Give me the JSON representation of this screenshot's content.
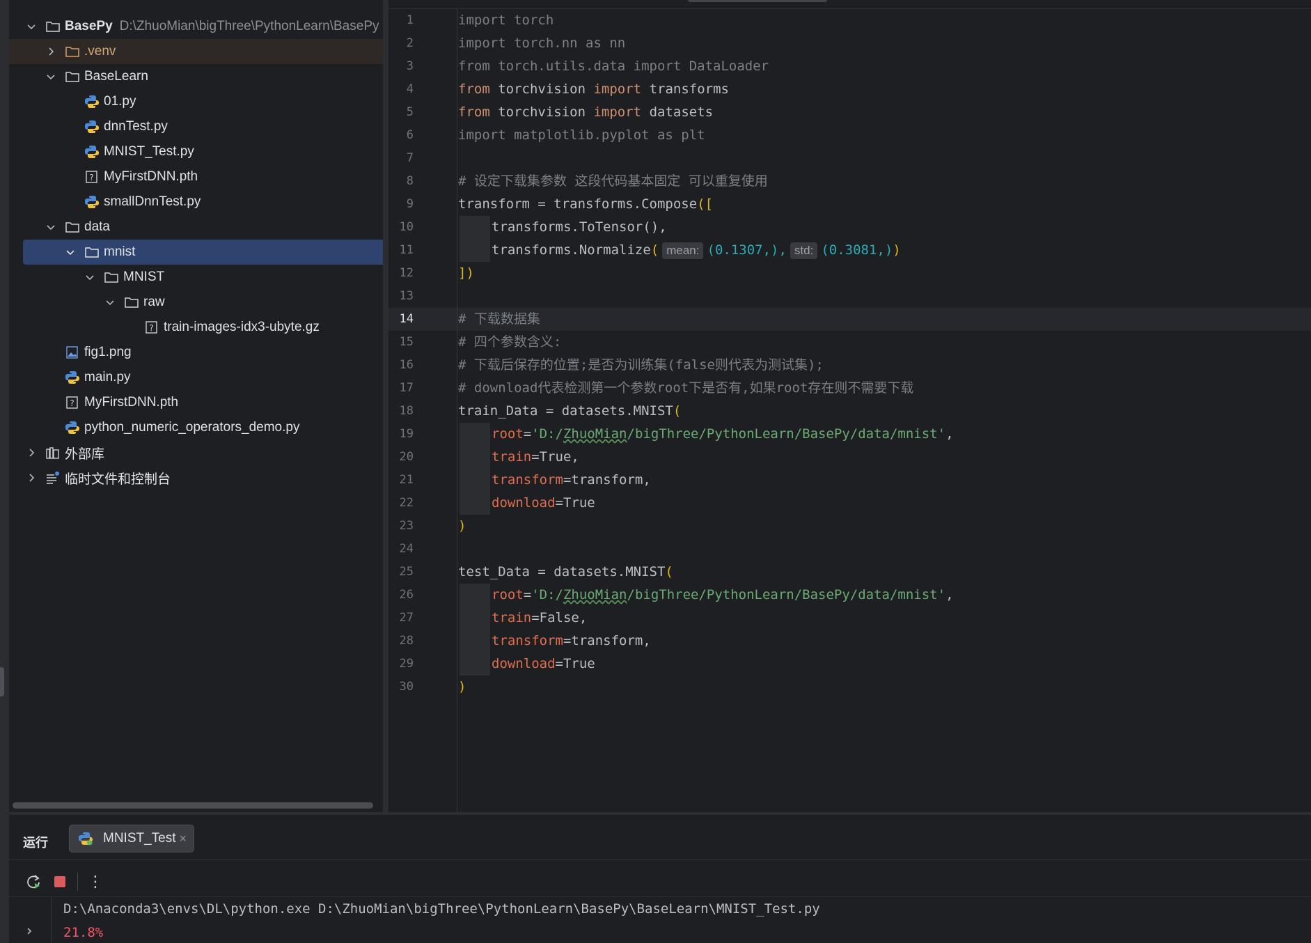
{
  "project_tree": {
    "root": {
      "label": "BasePy",
      "path": "D:\\ZhuoMian\\bigThree\\PythonLearn\\BasePy"
    },
    "items": [
      {
        "label": ".venv",
        "type": "folder-excluded",
        "expanded": false
      },
      {
        "label": "BaseLearn",
        "type": "folder",
        "expanded": true
      },
      {
        "label": "01.py",
        "type": "python"
      },
      {
        "label": "dnnTest.py",
        "type": "python"
      },
      {
        "label": "MNIST_Test.py",
        "type": "python"
      },
      {
        "label": "MyFirstDNN.pth",
        "type": "unknown"
      },
      {
        "label": "smallDnnTest.py",
        "type": "python"
      },
      {
        "label": "data",
        "type": "folder",
        "expanded": true
      },
      {
        "label": "mnist",
        "type": "folder",
        "expanded": true,
        "selected": true
      },
      {
        "label": "MNIST",
        "type": "folder",
        "expanded": true
      },
      {
        "label": "raw",
        "type": "folder",
        "expanded": true
      },
      {
        "label": "train-images-idx3-ubyte.gz",
        "type": "unknown"
      },
      {
        "label": "fig1.png",
        "type": "image"
      },
      {
        "label": "main.py",
        "type": "python"
      },
      {
        "label": "MyFirstDNN.pth",
        "type": "unknown"
      },
      {
        "label": "python_numeric_operators_demo.py",
        "type": "python"
      },
      {
        "label": "外部库",
        "type": "library",
        "expanded": false
      },
      {
        "label": "临时文件和控制台",
        "type": "scratches",
        "expanded": false
      }
    ]
  },
  "editor": {
    "active_line": "14",
    "line_numbers": [
      "1",
      "2",
      "3",
      "4",
      "5",
      "6",
      "7",
      "8",
      "9",
      "10",
      "11",
      "12",
      "13",
      "14",
      "15",
      "16",
      "17",
      "18",
      "19",
      "20",
      "21",
      "22",
      "23",
      "24",
      "25",
      "26",
      "27",
      "28",
      "29",
      "30"
    ],
    "code": {
      "l1": "import torch",
      "l2": "import torch.nn as nn",
      "l3": "from torch.utils.data import DataLoader",
      "l4_kw1": "from",
      "l4_mod": " torchvision ",
      "l4_kw2": "import",
      "l4_name": " transforms",
      "l5_kw1": "from",
      "l5_mod": " torchvision ",
      "l5_kw2": "import",
      "l5_name": " datasets",
      "l6": "import matplotlib.pyplot as plt",
      "l8": "# 设定下载集参数 这段代码基本固定 可以重复使用",
      "l9_code": "transform = transforms.Compose",
      "l9_br": "([",
      "l10": "transforms.ToTensor(),",
      "l11_code": "transforms.Normalize",
      "l11_open": "(",
      "l11_hint1": "mean:",
      "l11_tuple1_open": "(",
      "l11_val1": "0.1307",
      "l11_tuple1_close": ",),",
      "l11_hint2": "std:",
      "l11_tuple2_open": "(",
      "l11_val2": "0.3081",
      "l11_tuple2_close": ",)",
      "l11_close": ")",
      "l12": "])",
      "l14": "# 下载数据集",
      "l15": "# 四个参数含义:",
      "l16": "# 下载后保存的位置;是否为训练集(false则代表为测试集);",
      "l17": "# download代表检测第一个参数root下是否有,如果root存在则不需要下载",
      "l18_code": "train_Data = datasets.MNIST",
      "l18_br": "(",
      "l19_param": "root",
      "l19_eq": "=",
      "l19_str_a": "'D:/",
      "l19_str_b": "ZhuoMian",
      "l19_str_c": "/bigThree/PythonLearn/BasePy/data/mnist'",
      "l19_comma": ",",
      "l20_param": "train",
      "l20_rest": "=True,",
      "l21_param": "transform",
      "l21_rest": "=transform,",
      "l22_param": "download",
      "l22_rest": "=True",
      "l23": ")",
      "l25_code": "test_Data = datasets.MNIST",
      "l25_br": "(",
      "l26_param": "root",
      "l26_eq": "=",
      "l26_str_a": "'D:/",
      "l26_str_b": "ZhuoMian",
      "l26_str_c": "/bigThree/PythonLearn/BasePy/data/mnist'",
      "l26_comma": ",",
      "l27_param": "train",
      "l27_rest": "=False,",
      "l28_param": "transform",
      "l28_rest": "=transform,",
      "l29_param": "download",
      "l29_rest": "=True",
      "l30": ")"
    }
  },
  "run_panel": {
    "title": "运行",
    "tab_label": "MNIST_Test",
    "close_glyph": "×",
    "more_glyph": "⋮",
    "console_lines": [
      "D:\\Anaconda3\\envs\\DL\\python.exe D:\\ZhuoMian\\bigThree\\PythonLearn\\BasePy\\BaseLearn\\MNIST_Test.py",
      "21.8%"
    ]
  },
  "colors": {
    "background": "#1e1f22",
    "selection": "#2e436e",
    "keyword": "#cf8e6d",
    "string": "#6aab73",
    "number": "#2aacb8",
    "param": "#e06c4c",
    "progress": "#f75464"
  }
}
